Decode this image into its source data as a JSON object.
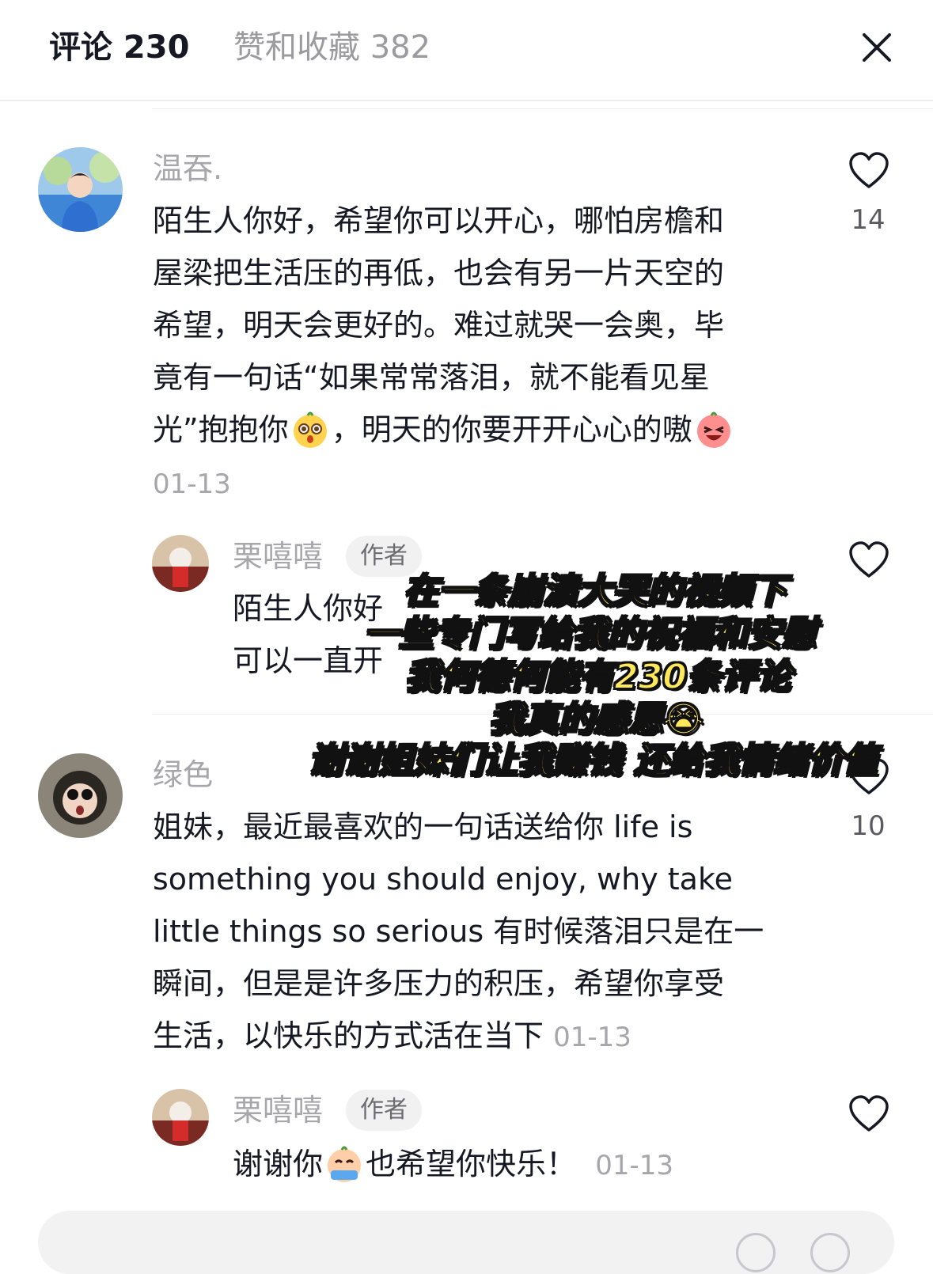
{
  "tabs": {
    "comments": "评论 230",
    "likes": "赞和收藏 382"
  },
  "comments": [
    {
      "username": "温吞.",
      "lines": [
        "陌生人你好，希望你可以开心，哪怕房檐和",
        "屋梁把生活压的再低，也会有另一片天空的",
        "希望，明天会更好的。难过就哭一会奥，毕",
        "竟有一句话“如果常常落泪，就不能看见星"
      ],
      "last_line_a": "光”抱抱你",
      "last_line_b": "，明天的你要开开心心的嗷",
      "date": "01-13",
      "likes": "14"
    },
    {
      "username": "绿色",
      "lines": [
        "姐妹，最近最喜欢的一句话送给你 life is",
        "something you should enjoy, why take",
        "little things so serious 有时候落泪只是在一",
        "瞬间，但是是许多压力的积压，希望你享受"
      ],
      "last_line": "生活，以快乐的方式活在当下",
      "date": "01-13",
      "likes": "10"
    }
  ],
  "replies": [
    {
      "username": "栗嘻嘻",
      "badge": "作者",
      "line1": "陌生人你好",
      "line2": "可以一直开"
    },
    {
      "username": "栗嘻嘻",
      "badge": "作者",
      "text_a": "谢谢你",
      "text_b": "也希望你快乐！",
      "date": "01-13"
    }
  ],
  "overlay_caption": [
    "在一条崩溃大哭的视频下",
    "一些专门写给我的祝福和安慰",
    "我何德何能有230条评论",
    "我真的感恩😭",
    "谢谢姐妹们让我赚钱 还给我情绪价值"
  ],
  "icons": {
    "close": "close-icon",
    "like": "heart-outline-icon"
  }
}
